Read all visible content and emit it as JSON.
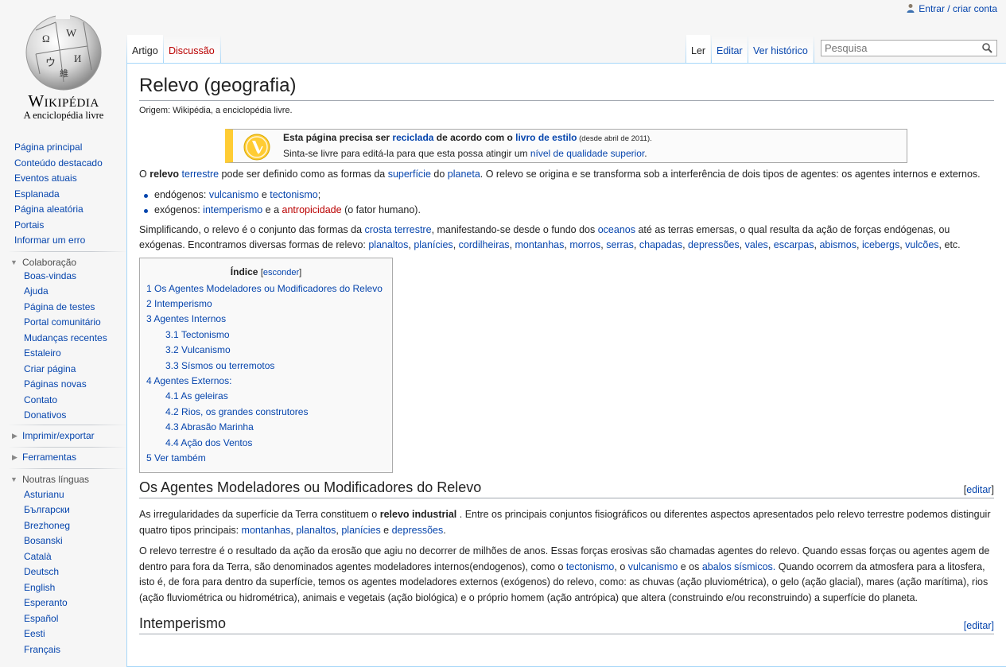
{
  "personal": {
    "login": "Entrar / criar conta"
  },
  "logo": {
    "wordmark": "Wikipédia",
    "tagline": "A enciclopédia livre"
  },
  "sidebar": {
    "main": [
      "Página principal",
      "Conteúdo destacado",
      "Eventos atuais",
      "Esplanada",
      "Página aleatória",
      "Portais",
      "Informar um erro"
    ],
    "collab_title": "Colaboração",
    "collab": [
      "Boas-vindas",
      "Ajuda",
      "Página de testes",
      "Portal comunitário",
      "Mudanças recentes",
      "Estaleiro",
      "Criar página",
      "Páginas novas",
      "Contato",
      "Donativos"
    ],
    "print_title": "Imprimir/exportar",
    "tools_title": "Ferramentas",
    "lang_title": "Noutras línguas",
    "langs": [
      "Asturianu",
      "Български",
      "Brezhoneg",
      "Bosanski",
      "Català",
      "Deutsch",
      "English",
      "Esperanto",
      "Español",
      "Eesti",
      "Français"
    ]
  },
  "tabs": {
    "article": "Artigo",
    "talk": "Discussão",
    "read": "Ler",
    "edit": "Editar",
    "history": "Ver histórico"
  },
  "search": {
    "placeholder": "Pesquisa"
  },
  "article": {
    "title": "Relevo (geografia)",
    "sitesub": "Origem: Wikipédia, a enciclopédia livre.",
    "notice": {
      "a": "Esta página precisa ser ",
      "b": "reciclada",
      "c": " de acordo com o ",
      "d": "livro de estilo",
      "e": " (desde abril de 2011).",
      "f": "Sinta-se livre para editá-la para que esta possa atingir um ",
      "g": "nível de qualidade superior",
      "h": "."
    },
    "p1": {
      "a": "O ",
      "b": "relevo",
      "c": " ",
      "d": "terrestre",
      "e": " pode ser definido como as formas da ",
      "f": "superfície",
      "g": " do ",
      "h": "planeta",
      "i": ". O relevo se origina e se transforma sob a interferência de dois tipos de agentes: os agentes internos e externos."
    },
    "bul1": {
      "a": "endógenos: ",
      "b": "vulcanismo",
      "c": " e ",
      "d": "tectonismo",
      "e": ";"
    },
    "bul2": {
      "a": "exógenos: ",
      "b": "intemperismo",
      "c": " e a ",
      "d": "antropicidade",
      "e": " (o fator humano)."
    },
    "p2": {
      "a": "Simplificando, o relevo é o conjunto das formas da ",
      "b": "crosta terrestre",
      "c": ", manifestando-se desde o fundo dos ",
      "d": "oceanos",
      "e": " até as terras emersas, o qual resulta da ação de forças endógenas, ou exógenas. Encontramos diversas formas de relevo: ",
      "l1": "planaltos",
      "l2": "planícies",
      "l3": "cordilheiras",
      "l4": "montanhas",
      "l5": "morros",
      "l6": "serras",
      "l7": "chapadas",
      "l8": "depressões",
      "l9": "vales",
      "l10": "escarpas",
      "l11": "abismos",
      "l12": "icebergs",
      "l13": "vulcões",
      "sep": ", ",
      "end": ", etc."
    },
    "toc": {
      "title": "Índice",
      "hide_open": "[",
      "hide": "esconder",
      "hide_close": "]",
      "items": [
        {
          "num": "1",
          "text": "Os Agentes Modeladores ou Modificadores do Relevo",
          "level": 1
        },
        {
          "num": "2",
          "text": "Intemperismo",
          "level": 1
        },
        {
          "num": "3",
          "text": "Agentes Internos",
          "level": 1
        },
        {
          "num": "3.1",
          "text": "Tectonismo",
          "level": 2
        },
        {
          "num": "3.2",
          "text": "Vulcanismo",
          "level": 2
        },
        {
          "num": "3.3",
          "text": "Sísmos ou terremotos",
          "level": 2
        },
        {
          "num": "4",
          "text": "Agentes Externos:",
          "level": 1
        },
        {
          "num": "4.1",
          "text": "As geleiras",
          "level": 2
        },
        {
          "num": "4.2",
          "text": "Rios, os grandes construtores",
          "level": 2
        },
        {
          "num": "4.3",
          "text": "Abrasão Marinha",
          "level": 2
        },
        {
          "num": "4.4",
          "text": "Ação dos Ventos",
          "level": 2
        },
        {
          "num": "5",
          "text": "Ver também",
          "level": 1
        }
      ]
    },
    "sec1": {
      "title": "Os Agentes Modeladores ou Modificadores do Relevo",
      "edit_open": "[",
      "edit": "editar",
      "edit_close": "]"
    },
    "p3": {
      "a": "As irregularidades da superfície da Terra constituem o ",
      "b": "relevo industrial",
      "c": " . Entre os principais conjuntos fisiográficos ou diferentes aspectos apresentados pelo relevo terrestre podemos distinguir quatro tipos principais: ",
      "d": "montanhas",
      "e": ", ",
      "f": "planaltos",
      "g": ", ",
      "h": "planícies",
      "i": " e ",
      "j": "depressões",
      "k": "."
    },
    "p4": {
      "a": "O relevo terrestre é o resultado da ação da erosão que agiu no decorrer de milhões de anos. Essas forças erosivas são chamadas agentes do relevo. Quando essas forças ou agentes agem de dentro para fora da Terra, são denominados agentes modeladores internos(endogenos), como o ",
      "b": "tectonismo",
      "c": ", o ",
      "d": "vulcanismo",
      "e": " e os ",
      "f": "abalos sísmicos.",
      "g": " Quando ocorrem da atmosfera para a litosfera, isto é, de fora para dentro da superfície, temos os agentes modeladores externos (exógenos) do relevo, como: as chuvas (ação pluviométrica), o gelo (ação glacial), mares (ação marítima), rios (ação fluviométrica ou hidrométrica), animais e vegetais (ação biológica) e o próprio homem (ação antrópica) que altera (construindo e/ou reconstruindo) a superfície do planeta."
    },
    "sec2": {
      "title": "Intemperismo",
      "edit": "[editar]"
    }
  }
}
